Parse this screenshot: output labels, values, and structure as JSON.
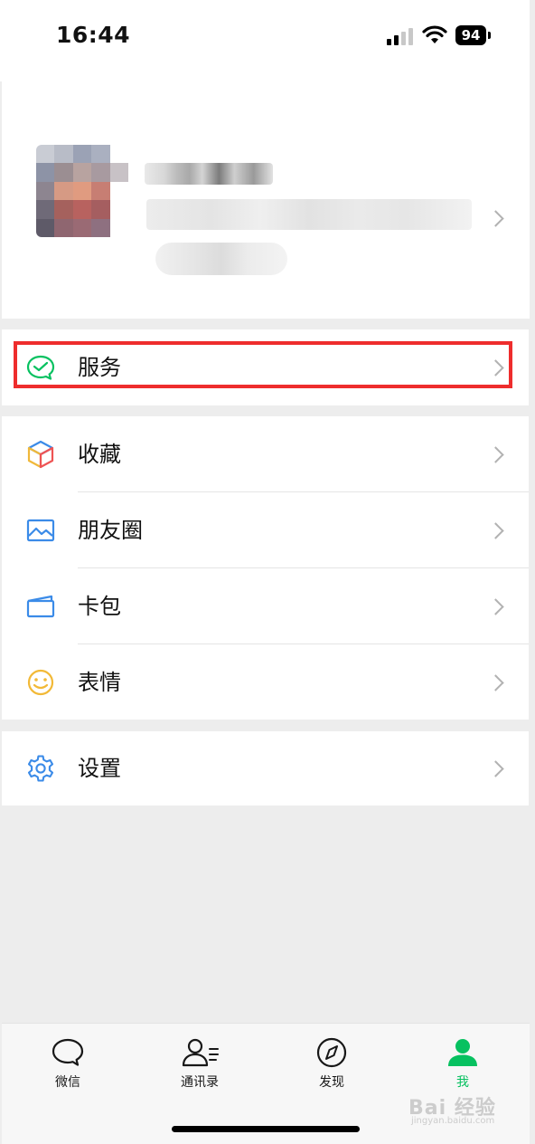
{
  "status_bar": {
    "time": "16:44",
    "battery": "94"
  },
  "menu": {
    "service": "服务",
    "favorites": "收藏",
    "moments": "朋友圈",
    "cards": "卡包",
    "stickers": "表情",
    "settings": "设置"
  },
  "tabs": {
    "chats": "微信",
    "contacts": "通讯录",
    "discover": "发现",
    "me": "我"
  },
  "watermark": {
    "main": "Bai 经验",
    "sub": "jingyan.baidu.com"
  },
  "colors": {
    "accent": "#07c160",
    "highlight_border": "#ee2d2d",
    "background": "#ededed"
  }
}
